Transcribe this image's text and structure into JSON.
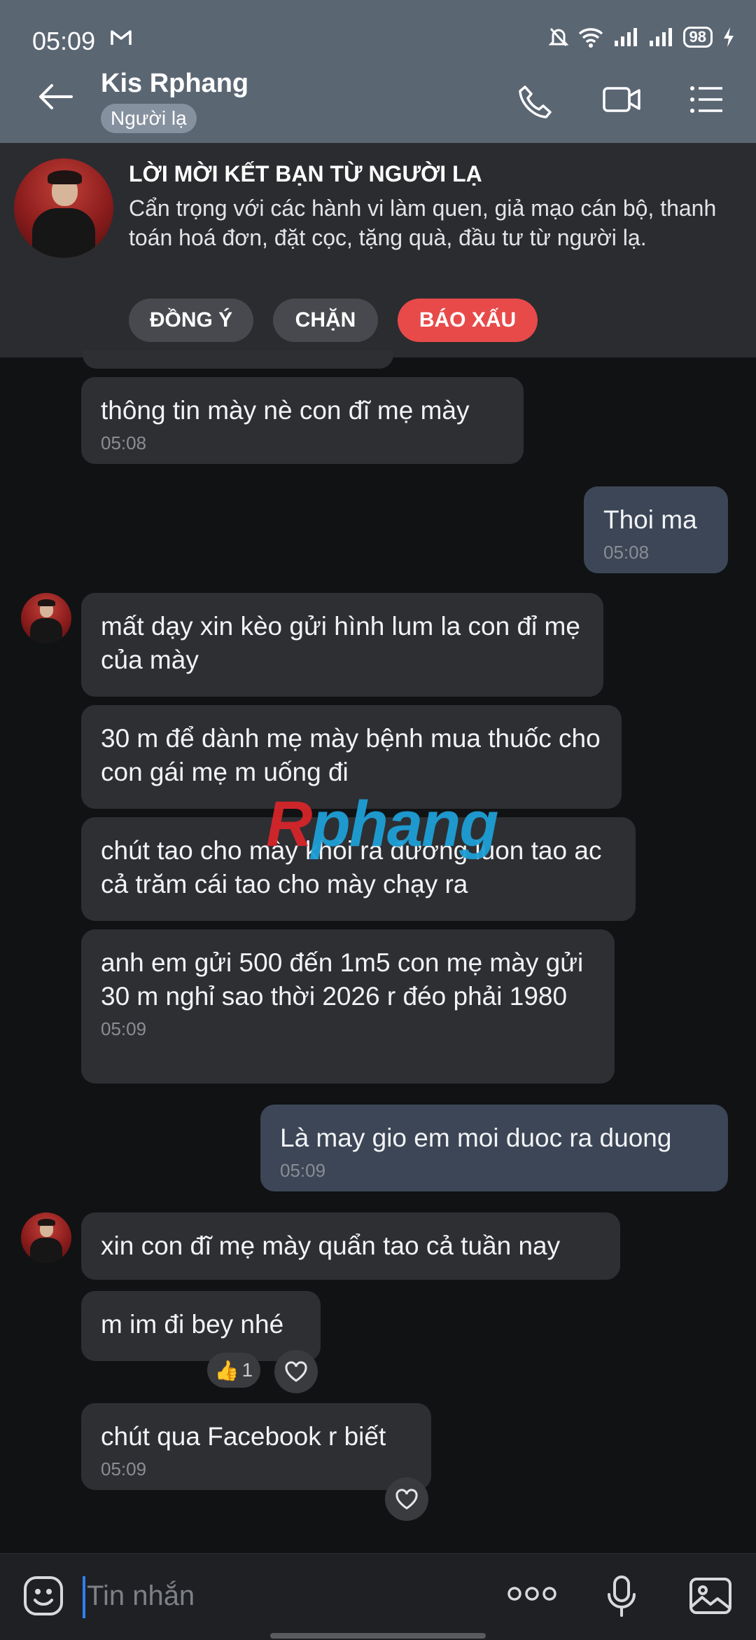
{
  "status": {
    "time": "05:09",
    "battery": "98"
  },
  "header": {
    "name": "Kis Rphang",
    "badge": "Người lạ"
  },
  "banner": {
    "title": "LỜI MỜI KẾT BẠN TỪ NGƯỜI LẠ",
    "text": "Cẩn trọng với các hành vi làm quen, giả mạo cán bộ, thanh toán hoá đơn, đặt cọc, tặng quà, đầu tư từ người lạ.",
    "accept": "ĐỒNG Ý",
    "block": "CHẶN",
    "report": "BÁO XẤU"
  },
  "messages": {
    "m1": {
      "text": "thông tin mày nè con đĩ mẹ mày",
      "time": "05:08"
    },
    "m2": {
      "text": "Thoi ma",
      "time": "05:08"
    },
    "m3": {
      "text": "mất dạy xin kèo gửi hình lum la con đỉ mẹ của mày"
    },
    "m4": {
      "text": "30 m để dành mẹ mày bệnh mua thuốc cho con gái mẹ m uống đi"
    },
    "m5": {
      "text": "chút tao cho mày khỏi ra đường luon tao ac cả trăm cái tao cho mày chạy ra"
    },
    "m6": {
      "text": "anh em gửi 500 đến 1m5 con mẹ mày gửi 30 m nghỉ sao thời 2026 r đéo phải 1980",
      "time": "05:09"
    },
    "m7": {
      "text": "Là may gio em moi duoc ra duong",
      "time": "05:09"
    },
    "m8": {
      "text": "xin con đĩ mẹ mày quẩn tao cả tuần nay"
    },
    "m9": {
      "text": "m im đi bey nhé",
      "reaction_count": "1"
    },
    "m10": {
      "text": "chút qua Facebook r biết",
      "time": "05:09"
    }
  },
  "watermark": {
    "r": "R",
    "rest": "phang"
  },
  "input": {
    "placeholder": "Tin nhắn"
  },
  "colors": {
    "report": "#e84a4a",
    "outgoing": "#3c4656",
    "incoming": "#2e2f33",
    "header": "#5b6673"
  }
}
